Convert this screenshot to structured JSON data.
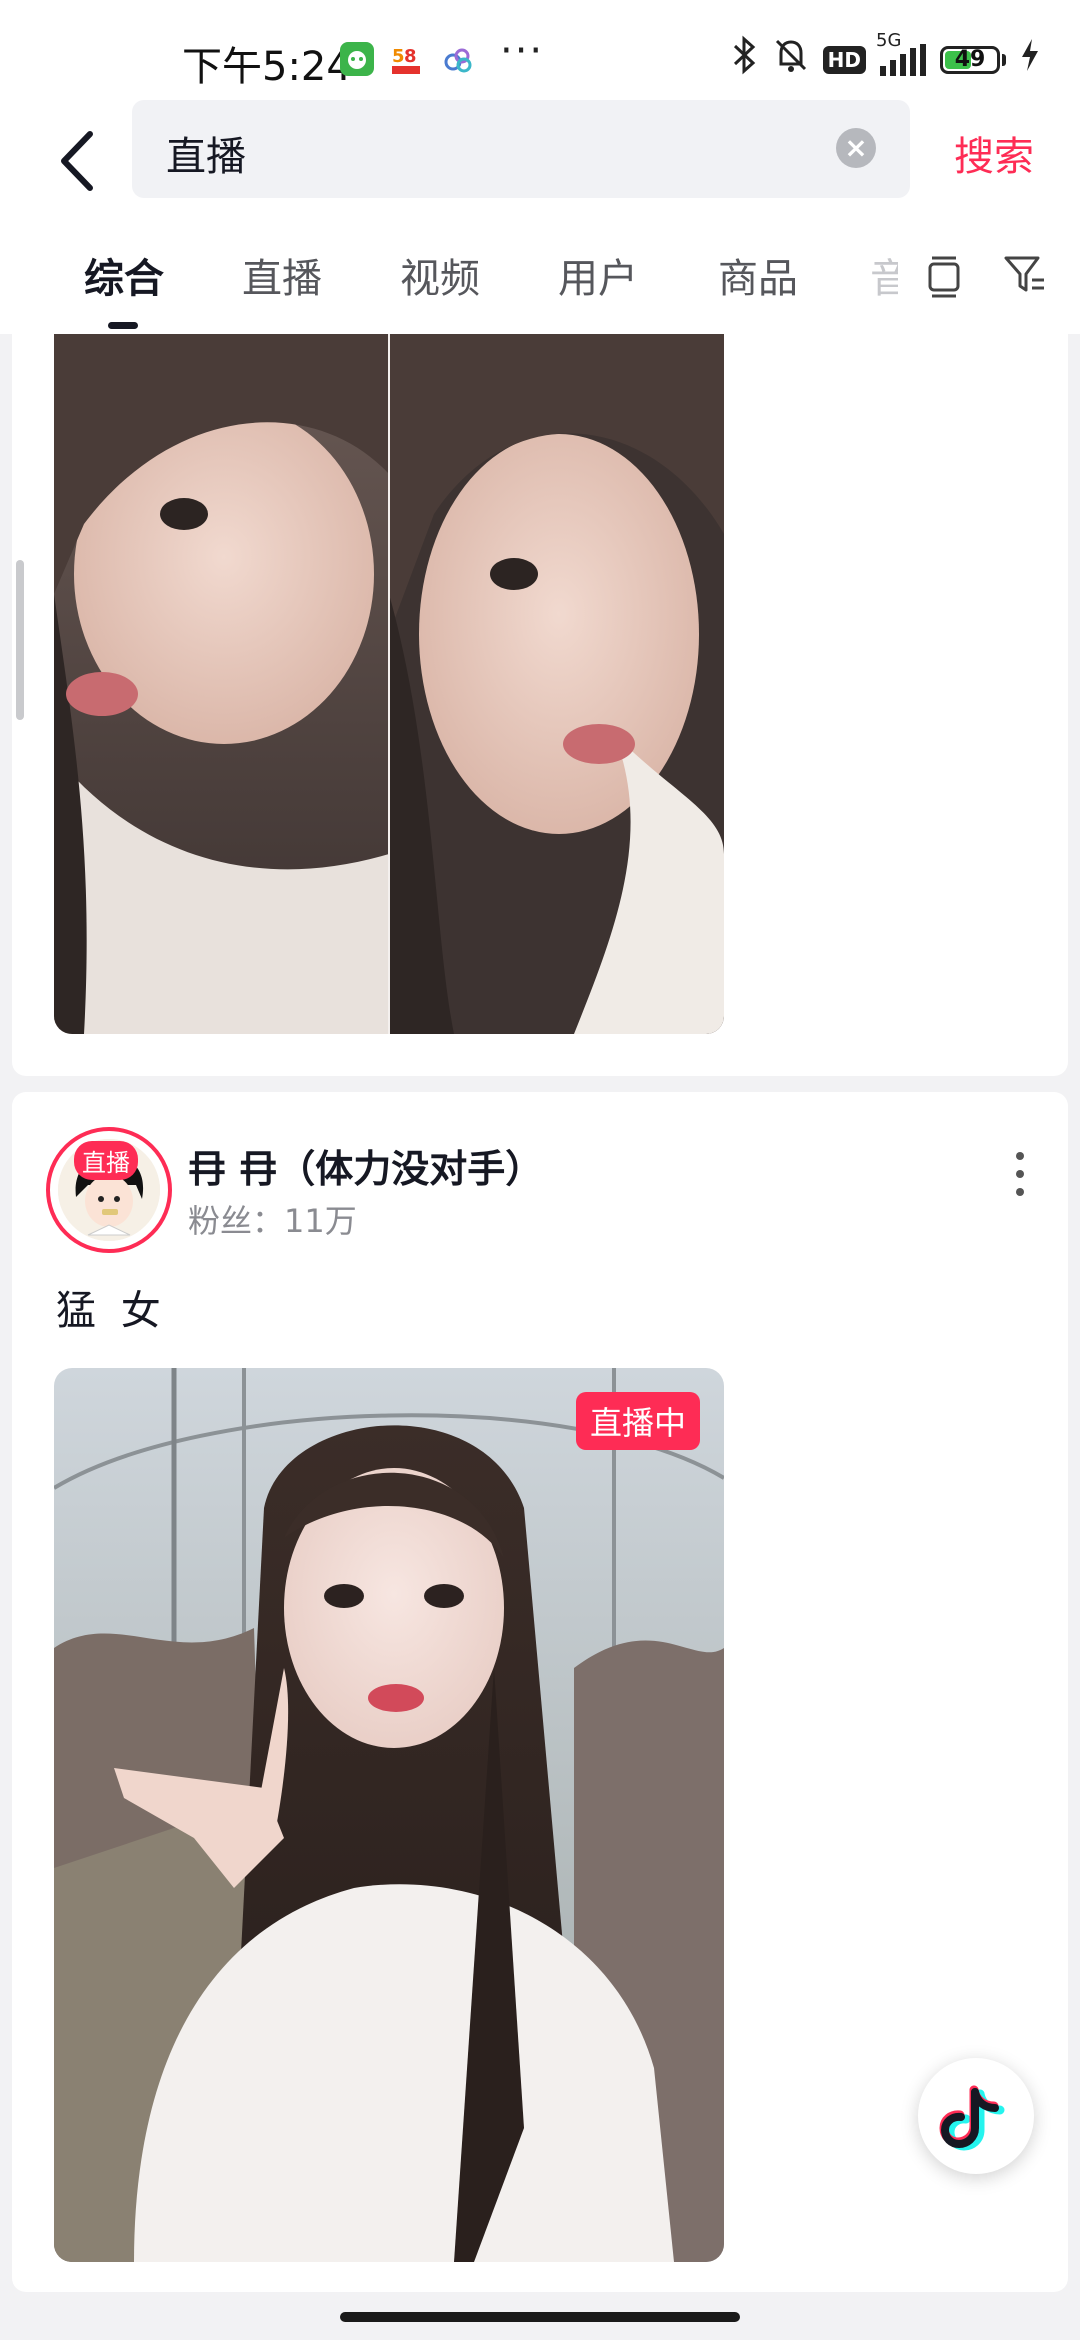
{
  "status_bar": {
    "time": "下午5:24",
    "network": "5G",
    "hd": "HD",
    "battery_level": "49",
    "battery_percent": 49,
    "icons": [
      "wechat-app-icon",
      "58-app-icon",
      "cloud-app-icon",
      "more-dots-icon",
      "bluetooth-icon",
      "mute-bell-icon",
      "hd-icon",
      "signal-icon",
      "battery-icon",
      "charging-icon"
    ]
  },
  "search": {
    "query": "直播",
    "submit_label": "搜索"
  },
  "tabs": [
    {
      "label": "综合",
      "active": true
    },
    {
      "label": "直播",
      "active": false
    },
    {
      "label": "视频",
      "active": false
    },
    {
      "label": "用户",
      "active": false
    },
    {
      "label": "商品",
      "active": false
    },
    {
      "label": "音",
      "active": false
    }
  ],
  "result": {
    "live_tag": "直播",
    "username": "冄 冄（体力没对手）",
    "fans_label": "粉丝：11万",
    "description": "猛 女",
    "live_badge": "直播中"
  },
  "colors": {
    "accent": "#fe2c55",
    "text_primary": "#161823",
    "text_secondary": "#8a8b91",
    "page_bg": "#f2f2f4"
  }
}
